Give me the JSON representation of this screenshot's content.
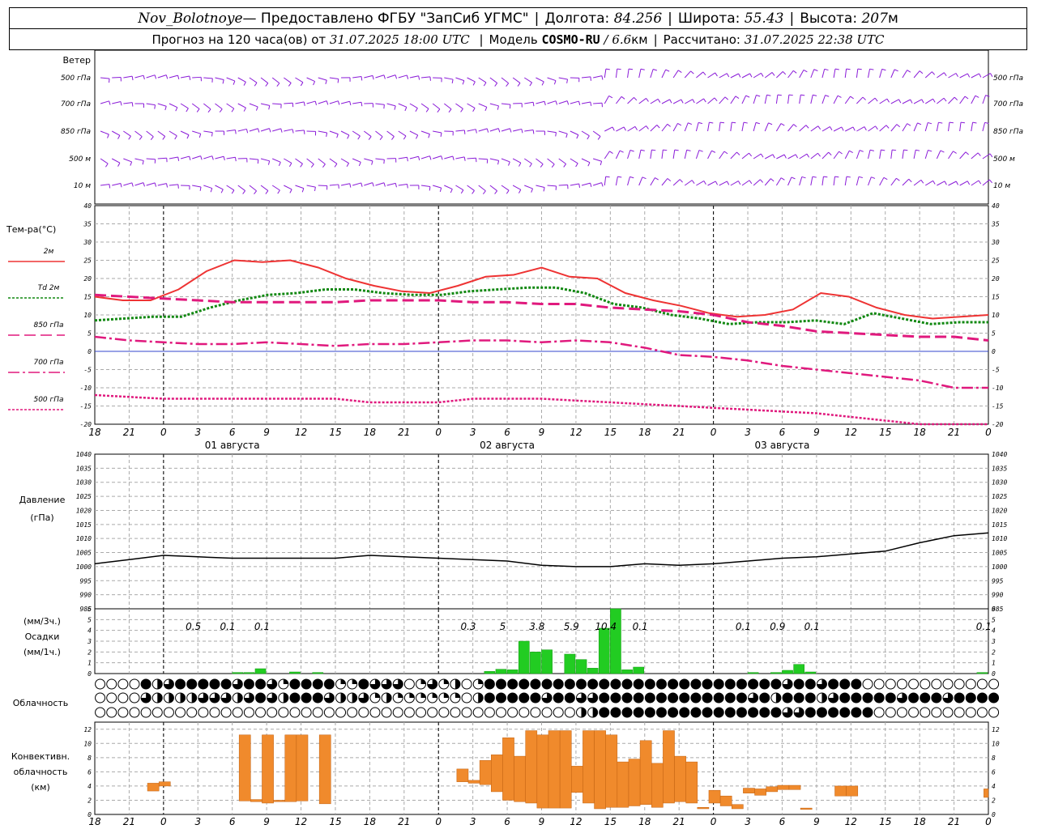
{
  "header": {
    "station": "Nov_Bolotnoye",
    "provider": " — Предоставлено ФГБУ \"ЗапСиб УГМС\"",
    "lon_label": "Долгота:",
    "lon_value": "84.256",
    "lat_label": "Широта:",
    "lat_value": "55.43",
    "alt_label": "Высота:",
    "alt_value": "207",
    "alt_unit": "м",
    "forecast_label": "Прогноз на 120 часа(ов) от",
    "forecast_start": "31.07.2025 18:00 UTC",
    "model_label": "Модель",
    "model_name": "COSMO-RU",
    "model_res": "/ 6.6",
    "model_res_unit": "км",
    "computed_label": "Рассчитано:",
    "computed_value": "31.07.2025 22:38 UTC"
  },
  "wind_panel": {
    "title": "Ветер",
    "levels": [
      "500 гПа",
      "700 гПа",
      "850 гПа",
      "500 м",
      "10  м"
    ],
    "barb_color": "#8a1bd8",
    "note": "wind barbs (direction/speed) at five levels, 3-hourly"
  },
  "colors": {
    "t2m": "#ee3333",
    "td2m": "#118811",
    "t850": "#e0197d",
    "t700": "#e0197d",
    "t500": "#e0197d",
    "zero_line": "#3344cc",
    "pressure": "#000000",
    "precip": "#22cc22",
    "convective": "#f08a2c",
    "grid": "#aaaaaa"
  },
  "time_axis": {
    "tick_labels": [
      "18",
      "21",
      "0",
      "3",
      "6",
      "9",
      "12",
      "15",
      "18",
      "21",
      "0",
      "3",
      "6",
      "9",
      "12",
      "15",
      "18",
      "21",
      "0",
      "3",
      "6",
      "9",
      "12",
      "15",
      "18",
      "21",
      "0"
    ],
    "dates": [
      "01 августа",
      "02 августа",
      "03 августа"
    ],
    "date_hours": [
      12,
      36,
      60
    ]
  },
  "chart_data": [
    {
      "type": "line",
      "title": "",
      "ylabel": "Тем-ра(°C)",
      "ylim": [
        -20,
        40
      ],
      "yticks": [
        "40",
        "35",
        "30",
        "25",
        "20",
        "15",
        "10",
        "5",
        "0",
        "-5",
        "-10",
        "-15",
        "-20"
      ],
      "x_hours": [
        0,
        3,
        6,
        9,
        12,
        15,
        18,
        21,
        24,
        27,
        30,
        33,
        36,
        39,
        42,
        45,
        48,
        51,
        54,
        57,
        60,
        63,
        66,
        69,
        72,
        75,
        78
      ],
      "legend": [
        "2м",
        "Td 2м",
        "850 гПа",
        "700 гПа",
        "500 гПа"
      ],
      "series": [
        {
          "name": "2м",
          "values": [
            15,
            14,
            14,
            17,
            22,
            25,
            24.5,
            25,
            23,
            20,
            18,
            16.5,
            16,
            18,
            20.5,
            21,
            23,
            20.5,
            20,
            16,
            14,
            12.5,
            10.5,
            9.5,
            10,
            11.5,
            16,
            15,
            12,
            10,
            9,
            9.5,
            10
          ]
        },
        {
          "name": "Td 2м",
          "values": [
            8.5,
            9,
            9.5,
            9.5,
            12,
            14,
            15.5,
            16,
            17,
            17,
            16,
            15.5,
            15.5,
            16.5,
            17,
            17.5,
            17.5,
            16,
            13,
            12,
            10,
            9,
            7.5,
            8,
            8,
            8.5,
            7.5,
            10.5,
            9,
            7.5,
            8,
            8
          ]
        },
        {
          "name": "850 гПа",
          "values": [
            15.5,
            15,
            14.5,
            14,
            13.5,
            13.5,
            13.5,
            13.5,
            14,
            14,
            14,
            13.5,
            13.5,
            13,
            13,
            12,
            11.5,
            11,
            10,
            8,
            7,
            5.5,
            5,
            4.5,
            4,
            4,
            3
          ]
        },
        {
          "name": "700 гПа",
          "values": [
            4,
            3,
            2.5,
            2,
            2,
            2.5,
            2,
            1.5,
            2,
            2,
            2.5,
            3,
            3,
            2.5,
            3,
            2.5,
            1,
            -1,
            -1.5,
            -2.5,
            -4,
            -5,
            -6,
            -7,
            -8,
            -10,
            -10
          ]
        },
        {
          "name": "500 гПа",
          "values": [
            -12,
            -12.5,
            -13,
            -13,
            -13,
            -13,
            -13,
            -13,
            -14,
            -14,
            -14,
            -13,
            -13,
            -13,
            -13.5,
            -14,
            -14.5,
            -15,
            -15.5,
            -16,
            -16.5,
            -17,
            -18,
            -19,
            -20,
            -20,
            -20
          ]
        }
      ]
    },
    {
      "type": "line",
      "ylabel": "Давление (гПа)",
      "ylim": [
        985,
        1040
      ],
      "yticks": [
        "1040",
        "1035",
        "1030",
        "1025",
        "1020",
        "1015",
        "1010",
        "1005",
        "1000",
        "995",
        "990",
        "985"
      ],
      "series": [
        {
          "name": "",
          "x_hours": [
            0,
            3,
            6,
            9,
            12,
            15,
            18,
            21,
            24,
            27,
            30,
            33,
            36,
            39,
            42,
            45,
            48,
            51,
            54,
            57,
            60,
            63,
            66,
            69,
            72,
            75,
            78
          ],
          "values": [
            1001,
            1002.5,
            1004,
            1003.5,
            1003,
            1003,
            1003,
            1003,
            1004,
            1003.5,
            1003,
            1002.5,
            1002,
            1000.5,
            1000,
            1000,
            1001,
            1000.5,
            1001,
            1002,
            1003,
            1003.5,
            1004.5,
            1005.5,
            1008.5,
            1011,
            1012
          ]
        }
      ]
    },
    {
      "type": "bar",
      "ylabel": "(мм/3ч.) Осадки (мм/1ч.)",
      "ylim": [
        0,
        6
      ],
      "yticks": [
        "6",
        "5",
        "4",
        "3",
        "2",
        "1",
        "0"
      ],
      "labels": [
        {
          "hour": 8.6,
          "text": "0.5"
        },
        {
          "hour": 11.6,
          "text": "0.1"
        },
        {
          "hour": 14.6,
          "text": "0.1"
        },
        {
          "hour": 32.6,
          "text": "0.3"
        },
        {
          "hour": 35.6,
          "text": "5"
        },
        {
          "hour": 38.6,
          "text": "3.8"
        },
        {
          "hour": 41.6,
          "text": "5.9"
        },
        {
          "hour": 44.6,
          "text": "10.4"
        },
        {
          "hour": 47.6,
          "text": "0.1"
        },
        {
          "hour": 56.6,
          "text": "0.1"
        },
        {
          "hour": 59.6,
          "text": "0.9"
        },
        {
          "hour": 62.6,
          "text": "0.1"
        },
        {
          "hour": 77.6,
          "text": "0.1"
        }
      ],
      "hourly": [
        {
          "h": 12,
          "v": 0.1
        },
        {
          "h": 13,
          "v": 0.1
        },
        {
          "h": 14,
          "v": 0.45
        },
        {
          "h": 17,
          "v": 0.15
        },
        {
          "h": 19,
          "v": 0.1
        },
        {
          "h": 34,
          "v": 0.2
        },
        {
          "h": 35,
          "v": 0.4
        },
        {
          "h": 36,
          "v": 0.35
        },
        {
          "h": 37,
          "v": 3.0
        },
        {
          "h": 38,
          "v": 2.0
        },
        {
          "h": 39,
          "v": 2.2
        },
        {
          "h": 41,
          "v": 1.8
        },
        {
          "h": 42,
          "v": 1.3
        },
        {
          "h": 43,
          "v": 0.5
        },
        {
          "h": 44,
          "v": 4.2
        },
        {
          "h": 45,
          "v": 6.0
        },
        {
          "h": 46,
          "v": 0.35
        },
        {
          "h": 47,
          "v": 0.6
        },
        {
          "h": 57,
          "v": 0.1
        },
        {
          "h": 59,
          "v": 0.1
        },
        {
          "h": 60,
          "v": 0.3
        },
        {
          "h": 61,
          "v": 0.85
        },
        {
          "h": 62,
          "v": 0.15
        },
        {
          "h": 77,
          "v": 0.1
        }
      ]
    },
    {
      "type": "heatmap",
      "ylabel": "Облачность",
      "rows": 3,
      "note": "cloud cover glyphs per hour (0=clear, 4=overcast)",
      "values": [
        [
          0,
          0,
          0,
          0,
          4,
          2,
          3,
          4,
          4,
          4,
          4,
          4,
          3,
          4,
          4,
          3,
          1,
          4,
          4,
          4,
          4,
          1,
          1,
          4,
          3,
          3,
          3,
          0,
          1,
          3,
          1,
          2,
          0,
          1,
          4,
          4,
          4,
          4,
          4,
          4,
          4,
          4,
          4,
          4,
          4,
          4,
          4,
          4,
          4,
          4,
          4,
          4,
          4,
          4,
          4,
          4,
          4,
          4,
          4,
          4,
          3,
          4,
          4,
          3,
          4,
          4,
          4,
          0,
          0,
          0,
          0,
          0,
          0,
          0,
          0,
          0,
          0,
          0,
          0
        ],
        [
          0,
          0,
          0,
          0,
          3,
          2,
          2,
          2,
          2,
          3,
          3,
          3,
          2,
          3,
          4,
          3,
          2,
          4,
          4,
          4,
          3,
          2,
          2,
          3,
          1,
          2,
          1,
          1,
          1,
          1,
          1,
          1,
          0,
          2,
          4,
          4,
          4,
          4,
          4,
          3,
          4,
          4,
          3,
          3,
          4,
          4,
          4,
          4,
          4,
          4,
          4,
          4,
          4,
          4,
          4,
          4,
          4,
          3,
          4,
          2,
          4,
          4,
          4,
          2,
          3,
          4,
          4,
          4,
          4,
          4,
          3,
          4,
          4,
          4,
          3,
          4,
          4,
          4,
          4,
          1
        ],
        [
          0,
          0,
          0,
          0,
          0,
          0,
          0,
          0,
          0,
          0,
          0,
          0,
          0,
          0,
          0,
          0,
          0,
          0,
          0,
          0,
          0,
          0,
          0,
          0,
          0,
          0,
          0,
          0,
          0,
          0,
          0,
          0,
          0,
          0,
          0,
          0,
          0,
          0,
          0,
          0,
          0,
          0,
          2,
          2,
          4,
          4,
          4,
          4,
          4,
          4,
          4,
          4,
          4,
          4,
          4,
          4,
          4,
          4,
          4,
          4,
          3,
          3,
          4,
          4,
          4,
          4,
          4,
          4,
          0,
          0,
          0,
          0,
          0,
          0,
          0,
          0,
          0,
          0,
          0,
          0,
          3,
          0,
          0,
          0
        ]
      ]
    },
    {
      "type": "bar",
      "ylabel": "Конвективн. облачность (км)",
      "ylim": [
        0,
        13
      ],
      "yticks": [
        "12",
        "10",
        "8",
        "6",
        "4",
        "2",
        "0"
      ],
      "bars": [
        {
          "h0": 4.6,
          "h1": 5.6,
          "lo": 3.3,
          "hi": 4.4
        },
        {
          "h0": 5.6,
          "h1": 6.6,
          "lo": 4.0,
          "hi": 4.6
        },
        {
          "h0": 12.6,
          "h1": 13.6,
          "lo": 1.9,
          "hi": 11.2
        },
        {
          "h0": 13.6,
          "h1": 14.6,
          "lo": 1.8,
          "hi": 2.1
        },
        {
          "h0": 14.6,
          "h1": 15.6,
          "lo": 1.6,
          "hi": 11.2
        },
        {
          "h0": 15.6,
          "h1": 16.6,
          "lo": 1.8,
          "hi": 2.0
        },
        {
          "h0": 16.6,
          "h1": 17.6,
          "lo": 1.8,
          "hi": 11.2
        },
        {
          "h0": 17.6,
          "h1": 18.6,
          "lo": 1.9,
          "hi": 11.2
        },
        {
          "h0": 19.6,
          "h1": 20.6,
          "lo": 1.5,
          "hi": 11.2
        },
        {
          "h0": 31.6,
          "h1": 32.6,
          "lo": 4.6,
          "hi": 6.4
        },
        {
          "h0": 32.6,
          "h1": 33.6,
          "lo": 4.4,
          "hi": 4.8
        },
        {
          "h0": 33.6,
          "h1": 34.6,
          "lo": 4.2,
          "hi": 7.6
        },
        {
          "h0": 34.6,
          "h1": 35.6,
          "lo": 3.2,
          "hi": 8.4
        },
        {
          "h0": 35.6,
          "h1": 36.6,
          "lo": 2.0,
          "hi": 10.8
        },
        {
          "h0": 36.6,
          "h1": 37.6,
          "lo": 1.8,
          "hi": 8.2
        },
        {
          "h0": 37.6,
          "h1": 38.6,
          "lo": 1.6,
          "hi": 11.8
        },
        {
          "h0": 38.6,
          "h1": 39.6,
          "lo": 0.9,
          "hi": 11.2
        },
        {
          "h0": 39.6,
          "h1": 40.6,
          "lo": 0.9,
          "hi": 11.8
        },
        {
          "h0": 40.6,
          "h1": 41.6,
          "lo": 0.9,
          "hi": 11.8
        },
        {
          "h0": 41.6,
          "h1": 42.6,
          "lo": 3.1,
          "hi": 6.8
        },
        {
          "h0": 42.6,
          "h1": 43.6,
          "lo": 1.6,
          "hi": 11.8
        },
        {
          "h0": 43.6,
          "h1": 44.6,
          "lo": 0.8,
          "hi": 11.8
        },
        {
          "h0": 44.6,
          "h1": 45.6,
          "lo": 1.0,
          "hi": 11.2
        },
        {
          "h0": 45.6,
          "h1": 46.6,
          "lo": 1.0,
          "hi": 7.4
        },
        {
          "h0": 46.6,
          "h1": 47.6,
          "lo": 1.2,
          "hi": 7.8
        },
        {
          "h0": 47.6,
          "h1": 48.6,
          "lo": 1.4,
          "hi": 10.4
        },
        {
          "h0": 48.6,
          "h1": 49.6,
          "lo": 1.0,
          "hi": 7.2
        },
        {
          "h0": 49.6,
          "h1": 50.6,
          "lo": 1.6,
          "hi": 11.8
        },
        {
          "h0": 50.6,
          "h1": 51.6,
          "lo": 1.8,
          "hi": 8.2
        },
        {
          "h0": 51.6,
          "h1": 52.6,
          "lo": 1.6,
          "hi": 7.4
        },
        {
          "h0": 52.6,
          "h1": 53.6,
          "lo": 0.8,
          "hi": 1.0
        },
        {
          "h0": 53.6,
          "h1": 54.6,
          "lo": 1.6,
          "hi": 3.4
        },
        {
          "h0": 54.6,
          "h1": 55.6,
          "lo": 1.2,
          "hi": 2.6
        },
        {
          "h0": 55.6,
          "h1": 56.6,
          "lo": 0.8,
          "hi": 1.4
        },
        {
          "h0": 56.6,
          "h1": 57.6,
          "lo": 3.0,
          "hi": 3.7
        },
        {
          "h0": 57.6,
          "h1": 58.6,
          "lo": 2.7,
          "hi": 3.6
        },
        {
          "h0": 58.6,
          "h1": 59.6,
          "lo": 3.2,
          "hi": 3.9
        },
        {
          "h0": 59.6,
          "h1": 60.6,
          "lo": 3.5,
          "hi": 4.1
        },
        {
          "h0": 60.6,
          "h1": 61.6,
          "lo": 3.5,
          "hi": 4.1
        },
        {
          "h0": 61.6,
          "h1": 62.6,
          "lo": 0.7,
          "hi": 0.9
        },
        {
          "h0": 64.6,
          "h1": 65.6,
          "lo": 2.6,
          "hi": 4.0
        },
        {
          "h0": 65.6,
          "h1": 66.6,
          "lo": 2.6,
          "hi": 4.0
        },
        {
          "h0": 77.6,
          "h1": 78.6,
          "lo": 2.4,
          "hi": 3.6
        },
        {
          "h0": 78.6,
          "h1": 79.6,
          "lo": 2.4,
          "hi": 3.6
        }
      ]
    }
  ]
}
